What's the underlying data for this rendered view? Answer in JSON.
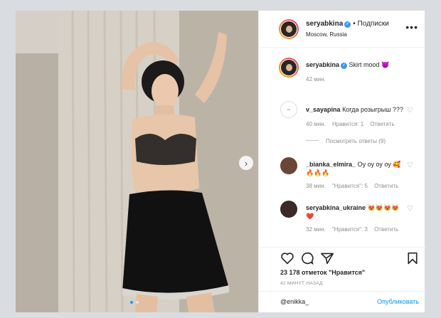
{
  "header": {
    "username": "seryabkina",
    "follow_label": "• Подписки",
    "location": "Moscow, Russia",
    "more_icon": "more-horizontal-icon"
  },
  "caption": {
    "username": "seryabkina",
    "text": "Skirt mood 😈",
    "time": "42 мин."
  },
  "comments": [
    {
      "username": "v_sayapina",
      "text": "Когда розыгрыш ???",
      "time": "40 мин.",
      "likes": "Нравится: 1",
      "reply": "Ответить"
    },
    {
      "username": "_bianka_elmira_",
      "text": "Оу оу оу оу 🥰🔥🔥🔥",
      "time": "38 мин.",
      "likes": "\"Нравится\": 5",
      "reply": "Ответить"
    },
    {
      "username": "seryabkina_ukraine",
      "text": "😻😻😻😻❤️",
      "time": "32 мин.",
      "likes": "\"Нравится\": 3",
      "reply": "Ответить"
    }
  ],
  "view_replies": "Посмотреть ответы (9)",
  "likes_count": "23 178 отметок \"Нравится\"",
  "time_ago": "42 МИНУТ НАЗАД",
  "composer": {
    "value": "@enikka_",
    "publish_label": "Опубликовать"
  },
  "colors": {
    "accent": "#0095f6",
    "verified": "#3897f0",
    "muted": "#8e8e8e"
  }
}
